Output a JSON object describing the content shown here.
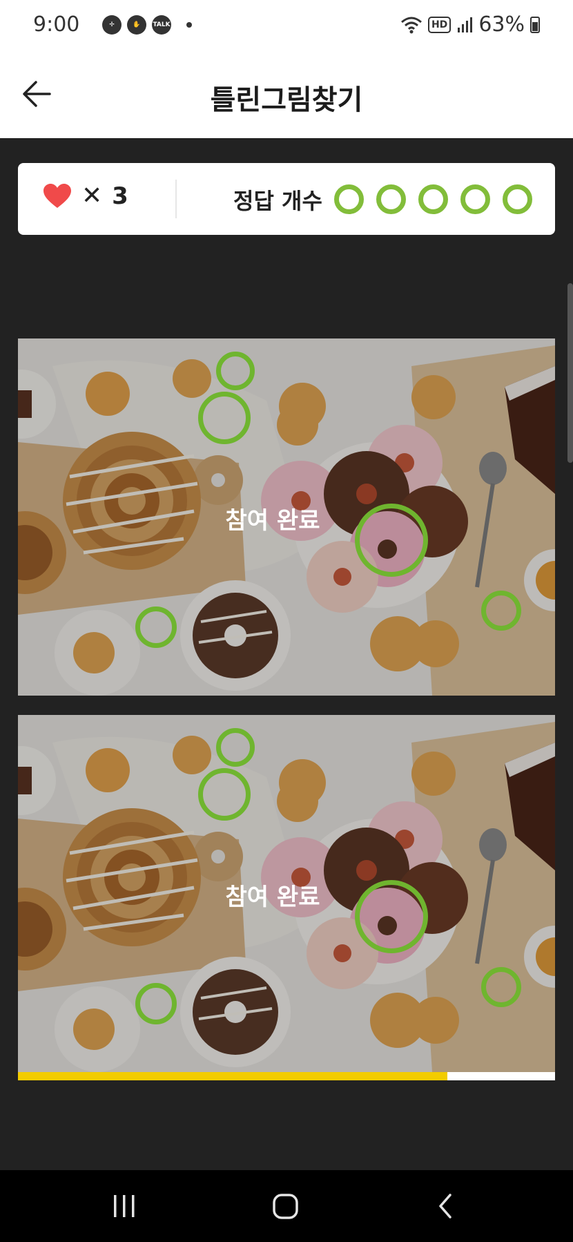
{
  "status_bar": {
    "time": "9:00",
    "talk_badge": "TALK",
    "hd_badge": "HD",
    "battery": "63%"
  },
  "header": {
    "title": "틀린그림찾기",
    "back_icon": "arrow-left-icon"
  },
  "score_card": {
    "lives_icon": "heart-icon",
    "lives_multiplier": "✕",
    "lives_count": "3",
    "answers_label": "정답 개수",
    "answers_found": 5,
    "answers_total": 5
  },
  "game": {
    "completed_label_top": "참여 완료",
    "completed_label_bottom": "참여 완료",
    "progress": 0.8
  },
  "colors": {
    "accent_green": "#82bd3a",
    "circle_green": "#6fb52f",
    "progress_yellow": "#f2cc00",
    "heart_red": "#f04a4a",
    "background_dark": "#222222"
  },
  "nav_bar": {
    "recent_icon": "recent-apps-icon",
    "home_icon": "home-icon",
    "back_icon": "back-chevron-icon"
  }
}
